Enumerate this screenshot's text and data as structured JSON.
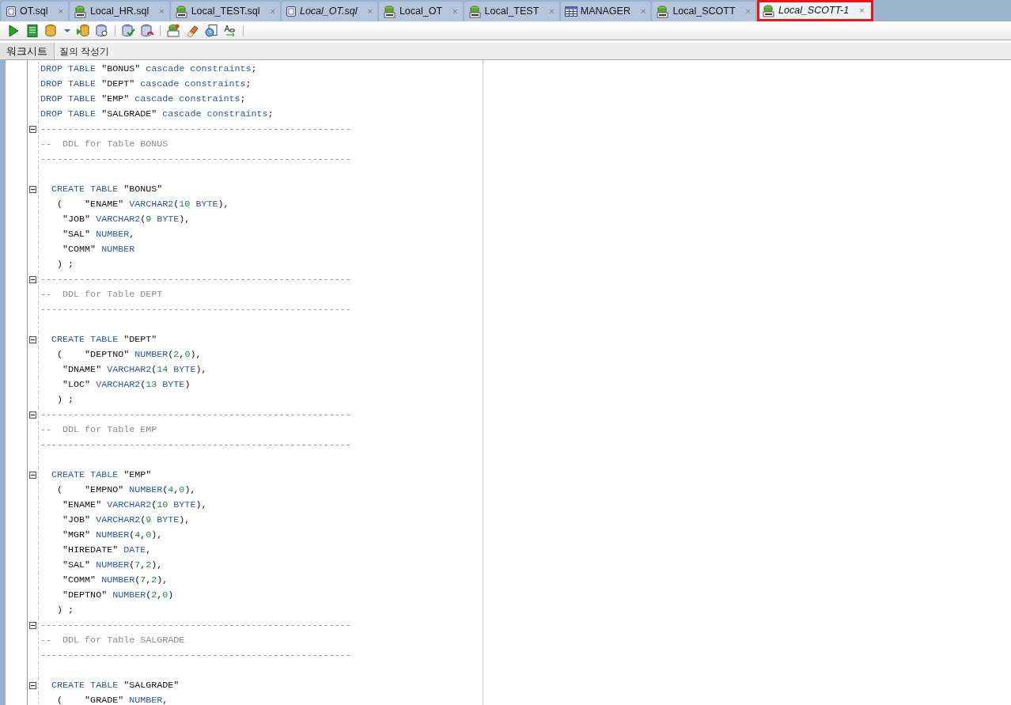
{
  "tabs": [
    {
      "label": "OT.sql",
      "kind": "file",
      "italic": false,
      "selected": false
    },
    {
      "label": "Local_HR.sql",
      "kind": "sql",
      "italic": false,
      "selected": false
    },
    {
      "label": "Local_TEST.sql",
      "kind": "sql",
      "italic": false,
      "selected": false
    },
    {
      "label": "Local_OT.sql",
      "kind": "file",
      "italic": true,
      "selected": false
    },
    {
      "label": "Local_OT",
      "kind": "sql",
      "italic": false,
      "selected": false
    },
    {
      "label": "Local_TEST",
      "kind": "sql",
      "italic": false,
      "selected": false
    },
    {
      "label": "MANAGER",
      "kind": "table",
      "italic": false,
      "selected": false
    },
    {
      "label": "Local_SCOTT",
      "kind": "sql",
      "italic": false,
      "selected": false
    },
    {
      "label": "Local_SCOTT-1",
      "kind": "sql",
      "italic": true,
      "selected": true
    }
  ],
  "close_glyph": "×",
  "subtabs": [
    {
      "label": "워크시트",
      "selected": true
    },
    {
      "label": "질의 작성기",
      "selected": false
    }
  ],
  "lines": [
    {
      "fold": false,
      "segs": [
        {
          "kind": "keyword",
          "text": "DROP TABLE "
        },
        {
          "kind": "string",
          "text": "\"BONUS\" "
        },
        {
          "kind": "keyword",
          "text": "cascade constraints"
        },
        {
          "kind": "plain",
          "text": ";"
        }
      ]
    },
    {
      "fold": false,
      "segs": [
        {
          "kind": "keyword",
          "text": "DROP TABLE "
        },
        {
          "kind": "string",
          "text": "\"DEPT\" "
        },
        {
          "kind": "keyword",
          "text": "cascade constraints"
        },
        {
          "kind": "plain",
          "text": ";"
        }
      ]
    },
    {
      "fold": false,
      "segs": [
        {
          "kind": "keyword",
          "text": "DROP TABLE "
        },
        {
          "kind": "string",
          "text": "\"EMP\" "
        },
        {
          "kind": "keyword",
          "text": "cascade constraints"
        },
        {
          "kind": "plain",
          "text": ";"
        }
      ]
    },
    {
      "fold": false,
      "segs": [
        {
          "kind": "keyword",
          "text": "DROP TABLE "
        },
        {
          "kind": "string",
          "text": "\"SALGRADE\" "
        },
        {
          "kind": "keyword",
          "text": "cascade constraints"
        },
        {
          "kind": "plain",
          "text": ";"
        }
      ]
    },
    {
      "fold": true,
      "segs": [
        {
          "kind": "comment",
          "text": "--------------------------------------------------------"
        }
      ]
    },
    {
      "fold": false,
      "segs": [
        {
          "kind": "comment",
          "text": "--  DDL for Table BONUS"
        }
      ]
    },
    {
      "fold": false,
      "segs": [
        {
          "kind": "comment",
          "text": "--------------------------------------------------------"
        }
      ]
    },
    {
      "fold": false
    },
    {
      "fold": true,
      "segs": [
        {
          "kind": "keyword",
          "text": "  CREATE TABLE "
        },
        {
          "kind": "string",
          "text": "\"BONUS\""
        }
      ]
    },
    {
      "fold": false,
      "segs": [
        {
          "kind": "plain",
          "text": "   (    \"ENAME\" "
        },
        {
          "kind": "keyword",
          "text": "VARCHAR2"
        },
        {
          "kind": "plain",
          "text": "("
        },
        {
          "kind": "number",
          "text": "10"
        },
        {
          "kind": "keyword",
          "text": " BYTE"
        },
        {
          "kind": "plain",
          "text": "),"
        }
      ]
    },
    {
      "fold": false,
      "segs": [
        {
          "kind": "plain",
          "text": "    \"JOB\" "
        },
        {
          "kind": "keyword",
          "text": "VARCHAR2"
        },
        {
          "kind": "plain",
          "text": "("
        },
        {
          "kind": "number",
          "text": "9"
        },
        {
          "kind": "keyword",
          "text": " BYTE"
        },
        {
          "kind": "plain",
          "text": "),"
        }
      ]
    },
    {
      "fold": false,
      "segs": [
        {
          "kind": "plain",
          "text": "    \"SAL\" "
        },
        {
          "kind": "keyword",
          "text": "NUMBER"
        },
        {
          "kind": "plain",
          "text": ","
        }
      ]
    },
    {
      "fold": false,
      "segs": [
        {
          "kind": "plain",
          "text": "    \"COMM\" "
        },
        {
          "kind": "keyword",
          "text": "NUMBER"
        }
      ]
    },
    {
      "fold": false,
      "segs": [
        {
          "kind": "plain",
          "text": "   ) ;"
        }
      ]
    },
    {
      "fold": true,
      "segs": [
        {
          "kind": "comment",
          "text": "--------------------------------------------------------"
        }
      ]
    },
    {
      "fold": false,
      "segs": [
        {
          "kind": "comment",
          "text": "--  DDL for Table DEPT"
        }
      ]
    },
    {
      "fold": false,
      "segs": [
        {
          "kind": "comment",
          "text": "--------------------------------------------------------"
        }
      ]
    },
    {
      "fold": false
    },
    {
      "fold": true,
      "segs": [
        {
          "kind": "keyword",
          "text": "  CREATE TABLE "
        },
        {
          "kind": "string",
          "text": "\"DEPT\""
        }
      ]
    },
    {
      "fold": false,
      "segs": [
        {
          "kind": "plain",
          "text": "   (    \"DEPTNO\" "
        },
        {
          "kind": "keyword",
          "text": "NUMBER"
        },
        {
          "kind": "plain",
          "text": "("
        },
        {
          "kind": "number",
          "text": "2"
        },
        {
          "kind": "plain",
          "text": ","
        },
        {
          "kind": "number",
          "text": "0"
        },
        {
          "kind": "plain",
          "text": "),"
        }
      ]
    },
    {
      "fold": false,
      "segs": [
        {
          "kind": "plain",
          "text": "    \"DNAME\" "
        },
        {
          "kind": "keyword",
          "text": "VARCHAR2"
        },
        {
          "kind": "plain",
          "text": "("
        },
        {
          "kind": "number",
          "text": "14"
        },
        {
          "kind": "keyword",
          "text": " BYTE"
        },
        {
          "kind": "plain",
          "text": "),"
        }
      ]
    },
    {
      "fold": false,
      "segs": [
        {
          "kind": "plain",
          "text": "    \"LOC\" "
        },
        {
          "kind": "keyword",
          "text": "VARCHAR2"
        },
        {
          "kind": "plain",
          "text": "("
        },
        {
          "kind": "number",
          "text": "13"
        },
        {
          "kind": "keyword",
          "text": " BYTE"
        },
        {
          "kind": "plain",
          "text": ")"
        }
      ]
    },
    {
      "fold": false,
      "segs": [
        {
          "kind": "plain",
          "text": "   ) ;"
        }
      ]
    },
    {
      "fold": true,
      "segs": [
        {
          "kind": "comment",
          "text": "--------------------------------------------------------"
        }
      ]
    },
    {
      "fold": false,
      "segs": [
        {
          "kind": "comment",
          "text": "--  DDL for Table EMP"
        }
      ]
    },
    {
      "fold": false,
      "segs": [
        {
          "kind": "comment",
          "text": "--------------------------------------------------------"
        }
      ]
    },
    {
      "fold": false
    },
    {
      "fold": true,
      "segs": [
        {
          "kind": "keyword",
          "text": "  CREATE TABLE "
        },
        {
          "kind": "string",
          "text": "\"EMP\""
        }
      ]
    },
    {
      "fold": false,
      "segs": [
        {
          "kind": "plain",
          "text": "   (    \"EMPNO\" "
        },
        {
          "kind": "keyword",
          "text": "NUMBER"
        },
        {
          "kind": "plain",
          "text": "("
        },
        {
          "kind": "number",
          "text": "4"
        },
        {
          "kind": "plain",
          "text": ","
        },
        {
          "kind": "number",
          "text": "0"
        },
        {
          "kind": "plain",
          "text": "),"
        }
      ]
    },
    {
      "fold": false,
      "segs": [
        {
          "kind": "plain",
          "text": "    \"ENAME\" "
        },
        {
          "kind": "keyword",
          "text": "VARCHAR2"
        },
        {
          "kind": "plain",
          "text": "("
        },
        {
          "kind": "number",
          "text": "10"
        },
        {
          "kind": "keyword",
          "text": " BYTE"
        },
        {
          "kind": "plain",
          "text": "),"
        }
      ]
    },
    {
      "fold": false,
      "segs": [
        {
          "kind": "plain",
          "text": "    \"JOB\" "
        },
        {
          "kind": "keyword",
          "text": "VARCHAR2"
        },
        {
          "kind": "plain",
          "text": "("
        },
        {
          "kind": "number",
          "text": "9"
        },
        {
          "kind": "keyword",
          "text": " BYTE"
        },
        {
          "kind": "plain",
          "text": "),"
        }
      ]
    },
    {
      "fold": false,
      "segs": [
        {
          "kind": "plain",
          "text": "    \"MGR\" "
        },
        {
          "kind": "keyword",
          "text": "NUMBER"
        },
        {
          "kind": "plain",
          "text": "("
        },
        {
          "kind": "number",
          "text": "4"
        },
        {
          "kind": "plain",
          "text": ","
        },
        {
          "kind": "number",
          "text": "0"
        },
        {
          "kind": "plain",
          "text": "),"
        }
      ]
    },
    {
      "fold": false,
      "segs": [
        {
          "kind": "plain",
          "text": "    \"HIREDATE\" "
        },
        {
          "kind": "keyword",
          "text": "DATE"
        },
        {
          "kind": "plain",
          "text": ","
        }
      ]
    },
    {
      "fold": false,
      "segs": [
        {
          "kind": "plain",
          "text": "    \"SAL\" "
        },
        {
          "kind": "keyword",
          "text": "NUMBER"
        },
        {
          "kind": "plain",
          "text": "("
        },
        {
          "kind": "number",
          "text": "7"
        },
        {
          "kind": "plain",
          "text": ","
        },
        {
          "kind": "number",
          "text": "2"
        },
        {
          "kind": "plain",
          "text": "),"
        }
      ]
    },
    {
      "fold": false,
      "segs": [
        {
          "kind": "plain",
          "text": "    \"COMM\" "
        },
        {
          "kind": "keyword",
          "text": "NUMBER"
        },
        {
          "kind": "plain",
          "text": "("
        },
        {
          "kind": "number",
          "text": "7"
        },
        {
          "kind": "plain",
          "text": ","
        },
        {
          "kind": "number",
          "text": "2"
        },
        {
          "kind": "plain",
          "text": "),"
        }
      ]
    },
    {
      "fold": false,
      "segs": [
        {
          "kind": "plain",
          "text": "    \"DEPTNO\" "
        },
        {
          "kind": "keyword",
          "text": "NUMBER"
        },
        {
          "kind": "plain",
          "text": "("
        },
        {
          "kind": "number",
          "text": "2"
        },
        {
          "kind": "plain",
          "text": ","
        },
        {
          "kind": "number",
          "text": "0"
        },
        {
          "kind": "plain",
          "text": ")"
        }
      ]
    },
    {
      "fold": false,
      "segs": [
        {
          "kind": "plain",
          "text": "   ) ;"
        }
      ]
    },
    {
      "fold": true,
      "segs": [
        {
          "kind": "comment",
          "text": "--------------------------------------------------------"
        }
      ]
    },
    {
      "fold": false,
      "segs": [
        {
          "kind": "comment",
          "text": "--  DDL for Table SALGRADE"
        }
      ]
    },
    {
      "fold": false,
      "segs": [
        {
          "kind": "comment",
          "text": "--------------------------------------------------------"
        }
      ]
    },
    {
      "fold": false
    },
    {
      "fold": true,
      "segs": [
        {
          "kind": "keyword",
          "text": "  CREATE TABLE "
        },
        {
          "kind": "string",
          "text": "\"SALGRADE\""
        }
      ]
    },
    {
      "fold": false,
      "segs": [
        {
          "kind": "plain",
          "text": "   (    \"GRADE\" "
        },
        {
          "kind": "keyword",
          "text": "NUMBER"
        },
        {
          "kind": "plain",
          "text": ","
        }
      ]
    }
  ]
}
